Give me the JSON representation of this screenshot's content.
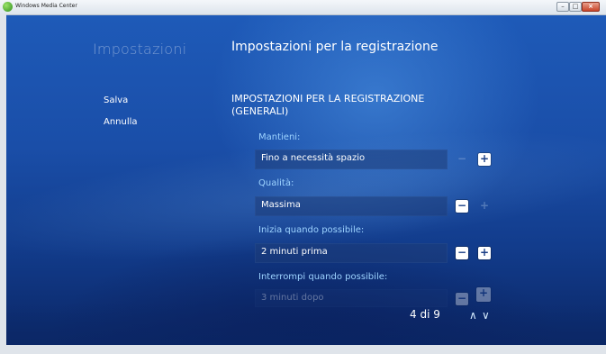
{
  "window": {
    "title": "Windows Media Center",
    "min_icon": "minimize-icon",
    "max_icon": "maximize-icon",
    "close_icon": "close-icon"
  },
  "header": {
    "section": "Impostazioni",
    "page_title": "Impostazioni per la registrazione"
  },
  "menu": {
    "save": "Salva",
    "cancel": "Annulla"
  },
  "group": {
    "title": "IMPOSTAZIONI PER LA REGISTRAZIONE (GENERALI)"
  },
  "settings": [
    {
      "label": "Mantieni:",
      "value": "Fino a necessità spazio",
      "minus": "−",
      "plus": "+",
      "minus_enabled": false,
      "plus_enabled": true
    },
    {
      "label": "Qualità:",
      "value": "Massima",
      "minus": "−",
      "plus": "+",
      "minus_enabled": true,
      "plus_enabled": false
    },
    {
      "label": "Inizia quando possibile:",
      "value": "2 minuti prima",
      "minus": "−",
      "plus": "+",
      "minus_enabled": true,
      "plus_enabled": true
    },
    {
      "label": "Interrompi quando possibile:",
      "value": "3 minuti dopo",
      "minus": "−",
      "plus": "+",
      "minus_enabled": true,
      "plus_enabled": true
    }
  ],
  "pager": {
    "text": "4 di 9",
    "up": "∧",
    "down": "∨"
  },
  "colors": {
    "background": "#1a4ea8",
    "label": "#9dd3ff",
    "text": "#ffffff"
  }
}
